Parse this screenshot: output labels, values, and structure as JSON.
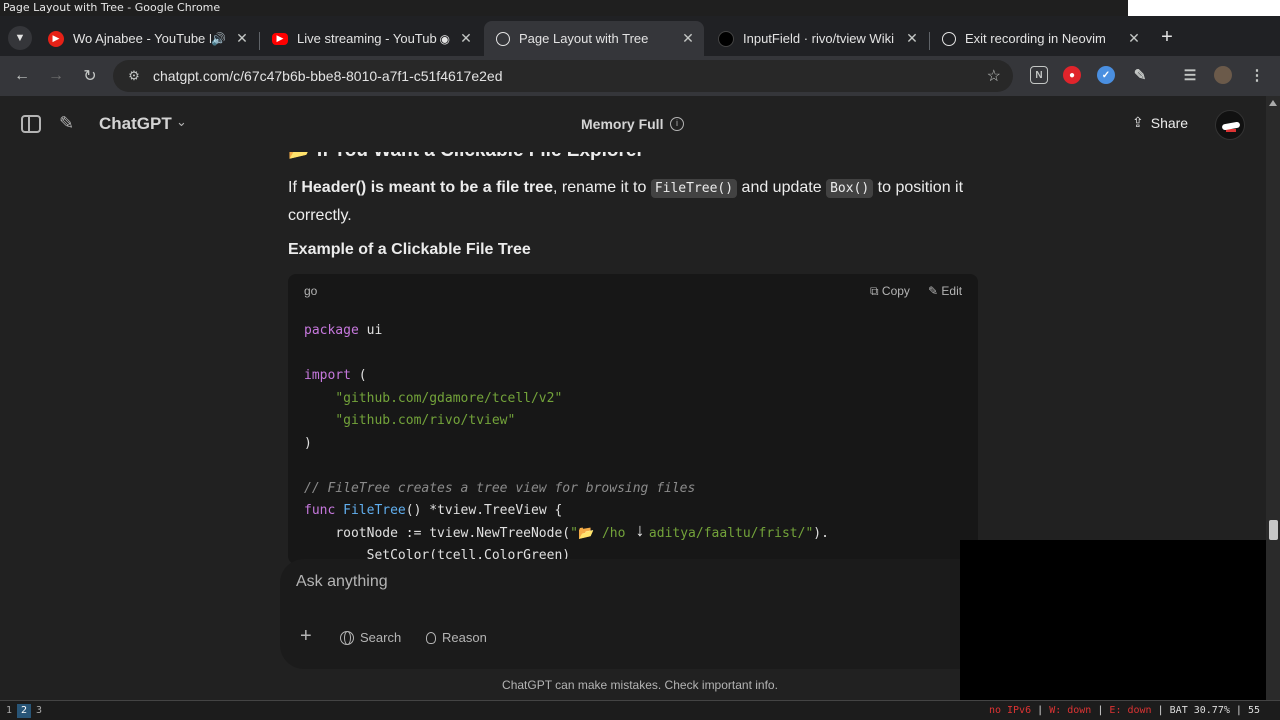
{
  "os": {
    "window_title": "Page Layout with Tree - Google Chrome"
  },
  "browser": {
    "tabs": [
      {
        "title": "Wo Ajnabee - YouTube M",
        "favicon": "youtube-music-icon",
        "audio": true
      },
      {
        "title": "Live streaming - YouTub",
        "favicon": "youtube-icon",
        "recording": true
      },
      {
        "title": "Page Layout with Tree",
        "favicon": "chatgpt-icon",
        "active": true
      },
      {
        "title": "InputField · rivo/tview Wiki",
        "favicon": "github-icon"
      },
      {
        "title": "Exit recording in Neovim",
        "favicon": "chatgpt-icon"
      }
    ],
    "url": "chatgpt.com/c/67c47b6b-bbe8-8010-a7f1-c51f4617e2ed"
  },
  "app": {
    "model": "ChatGPT",
    "memory": "Memory Full",
    "share_label": "Share"
  },
  "chat": {
    "heading": "📂 If You Want a Clickable File Explorer",
    "para": {
      "p1": "If ",
      "b1": "Header() is meant to be a file tree",
      "p2": ", rename it to ",
      "c1": "FileTree()",
      "p3": " and update ",
      "c2": "Box()",
      "p4": " to position it correctly."
    },
    "example_heading": "Example of a Clickable File Tree",
    "code": {
      "language": "go",
      "copy_label": "Copy",
      "edit_label": "Edit",
      "l1_kw": "package",
      "l1_rest": " ui",
      "l3_kw": "import",
      "l3_rest": " (",
      "l4": "\"github.com/gdamore/tcell/v2\"",
      "l5": "\"github.com/rivo/tview\"",
      "l6": ")",
      "l8": "// FileTree creates a tree view for browsing files",
      "l9_kw": "func",
      "l9_fn": "FileTree",
      "l9_rest": "() *tview.TreeView {",
      "l10_pre": "rootNode := tview.NewTreeNode(",
      "l10_str": "\"📂 /ho   aditya/faaltu/frist/\"",
      "l10_post": ").",
      "l11": "SetColor(tcell.ColorGreen)"
    }
  },
  "composer": {
    "placeholder": "Ask anything",
    "search_label": "Search",
    "reason_label": "Reason"
  },
  "disclaimer": "ChatGPT can make mistakes. Check important info.",
  "statusbar": {
    "workspaces": [
      "1",
      "2",
      "3"
    ],
    "active_workspace": "2",
    "ipv6": "no IPv6",
    "wifi": "W: down",
    "eth": "E: down",
    "battery": "BAT 30.77%",
    "extra": "55"
  }
}
